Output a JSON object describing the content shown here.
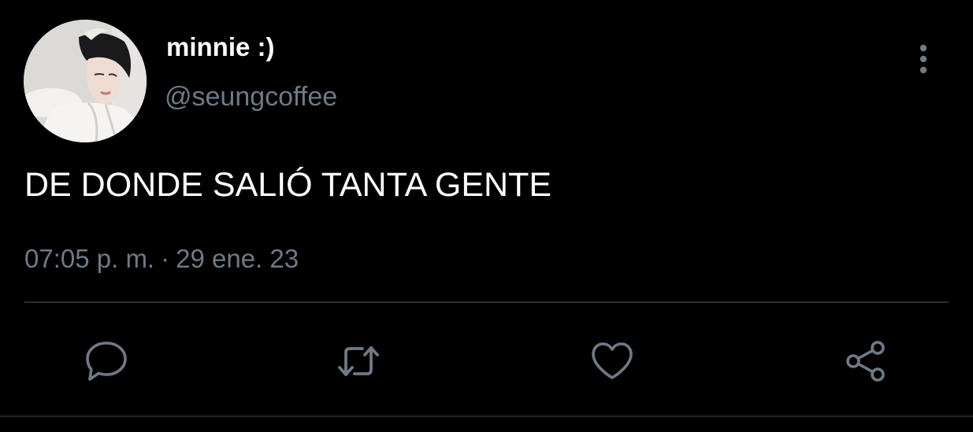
{
  "colors": {
    "background": "#000000",
    "primary_text": "#ffffff",
    "secondary_text": "#6e7a86",
    "divider": "#2a2f35"
  },
  "author": {
    "display_name": "minnie :)",
    "handle": "@seungcoffee",
    "avatar_icon": "profile-photo"
  },
  "tweet": {
    "text": "DE DONDE SALIÓ TANTA GENTE",
    "time": "07:05 p. m.",
    "separator": "·",
    "date": "29 ene. 23"
  },
  "actions": [
    {
      "icon": "reply-icon"
    },
    {
      "icon": "retweet-icon"
    },
    {
      "icon": "like-icon"
    },
    {
      "icon": "share-icon"
    }
  ],
  "menu": {
    "icon": "more-vertical-icon"
  }
}
